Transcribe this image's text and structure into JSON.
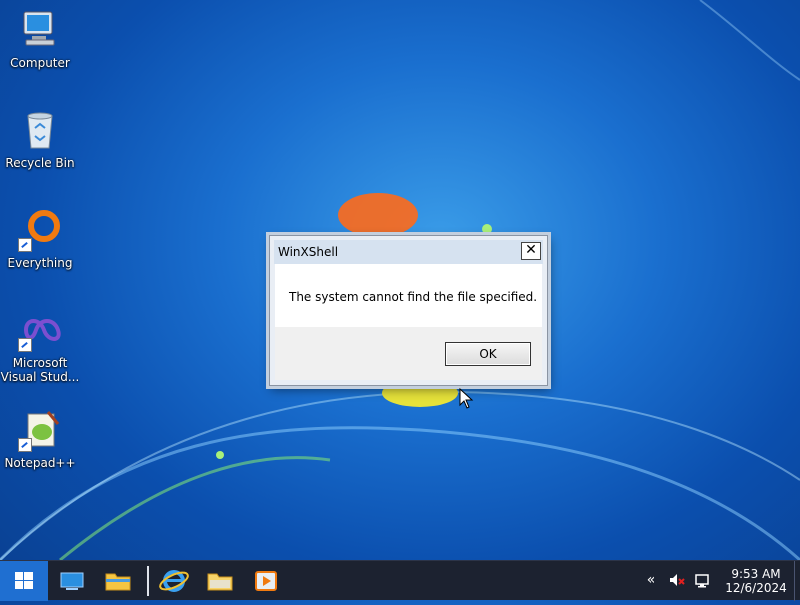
{
  "desktop": {
    "icons": [
      {
        "label": "Computer",
        "icon": "computer-icon"
      },
      {
        "label": "Recycle Bin",
        "icon": "recycle-bin-icon"
      },
      {
        "label": "Everything",
        "icon": "everything-icon"
      },
      {
        "label": "Microsoft Visual Stud...",
        "icon": "visual-studio-icon"
      },
      {
        "label": "Notepad++",
        "icon": "notepad-plus-plus-icon"
      }
    ]
  },
  "dialog": {
    "title": "WinXShell",
    "close_glyph": "✕",
    "message": "The system cannot find the file specified.",
    "ok_label": "OK"
  },
  "taskbar": {
    "pinned": [
      {
        "icon": "task-view-icon"
      },
      {
        "icon": "file-explorer-icon"
      },
      {
        "icon": "internet-explorer-icon"
      },
      {
        "icon": "folder-icon"
      },
      {
        "icon": "media-player-icon"
      }
    ],
    "tray": {
      "overflow_glyph": "«",
      "icons": [
        "chevron-icon",
        "volume-muted-icon",
        "network-icon"
      ]
    },
    "clock": {
      "time": "9:53 AM",
      "date": "12/6/2024"
    }
  },
  "colors": {
    "desktop_bg": "#1a6fcf",
    "taskbar_bg": "#1c2230",
    "start_bg": "#1f6fd1"
  }
}
